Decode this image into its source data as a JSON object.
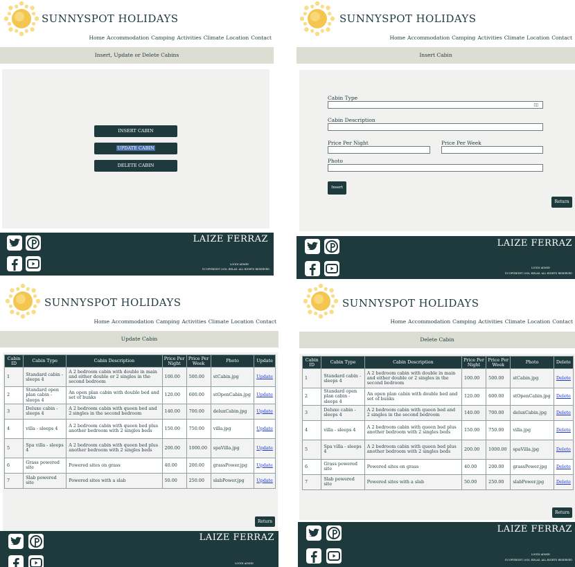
{
  "brand": "SUNNYSPOT HOLIDAYS",
  "nav": [
    "Home",
    "Accommodation",
    "Camping",
    "Activities",
    "Climate",
    "Location",
    "Contact"
  ],
  "footer": {
    "name": "LAIZE FERRAZ",
    "login": "LOGIN ADMIN",
    "copyright": "©COPYRIGHT 2016, RELAX. ALL RIGHTS RESERVED"
  },
  "icons": [
    "twitter-icon",
    "pinterest-icon",
    "facebook-icon",
    "youtube-icon",
    "sun-logo-icon"
  ],
  "colors": {
    "primary": "#1f3a3d",
    "titlebar": "#dcddd3",
    "link": "#1a35d6",
    "background": "#f1f1ef"
  },
  "panel1": {
    "title": "Insert, Update or Delete Cabins",
    "buttons": [
      "INSERT CABIN",
      "UPDATE CABIN",
      "DELETE CABIN"
    ]
  },
  "panel2": {
    "title": "Insert Cabin",
    "labels": {
      "cabin_type": "Cabin Type",
      "cabin_description": "Cabin Description",
      "price_night": "Price Per Night",
      "price_week": "Price Per Week",
      "photo": "Photo"
    },
    "insert_button": "Insert",
    "return_button": "Return"
  },
  "panel3": {
    "title": "Update Cabin",
    "action_header": "Update",
    "action_link": "Update",
    "return_button": "Return"
  },
  "panel4": {
    "title": "Delete Cabin",
    "action_header": "Delete",
    "action_link": "Delete",
    "return_button": "Return"
  },
  "table": {
    "headers": [
      "Cabin ID",
      "Cabin Type",
      "Cabin Description",
      "Price Per Night",
      "Price Per Week",
      "Photo"
    ],
    "rows": [
      {
        "id": "1",
        "type": "Standard cabin - sleeps 4",
        "desc": "A 2 bedroom cabin with double in main and either double or 2 singles in the second bedroom",
        "night": "100.00",
        "week": "500.00",
        "photo": "stCabin.jpg"
      },
      {
        "id": "2",
        "type": "Standard open plan cabin - sleeps 4",
        "desc": "An open plan cabin with double bed and set of bunks",
        "night": "120.00",
        "week": "600.00",
        "photo": "stOpenCabin.jpg"
      },
      {
        "id": "3",
        "type": "Deluxe cabin - sleeps 4",
        "desc": "A 2 bedroom cabin with queen bed and 2 singles in the second bedroom",
        "night": "140.00",
        "week": "700.00",
        "photo": "deluxCabin.jpg"
      },
      {
        "id": "4",
        "type": "villa - sleeps 4",
        "desc": "A 2 bedroom cabin with queen bed plus another bedroom with 2 singles beds",
        "night": "150.00",
        "week": "750.00",
        "photo": "villa.jpg"
      },
      {
        "id": "5",
        "type": "Spa villa - sleeps 4",
        "desc": "A 2 bedroom cabin with queen bed plus another bedroom with 2 singles beds",
        "night": "200.00",
        "week": "1000.00",
        "photo": "spaVilla.jpg"
      },
      {
        "id": "6",
        "type": "Grass powered site",
        "desc": "Powered sites on grass",
        "night": "40.00",
        "week": "200.00",
        "photo": "grassPower.jpg"
      },
      {
        "id": "7",
        "type": "Slab powered site",
        "desc": "Powered sites with a slab",
        "night": "50.00",
        "week": "250.00",
        "photo": "slabPower.jpg"
      }
    ]
  }
}
